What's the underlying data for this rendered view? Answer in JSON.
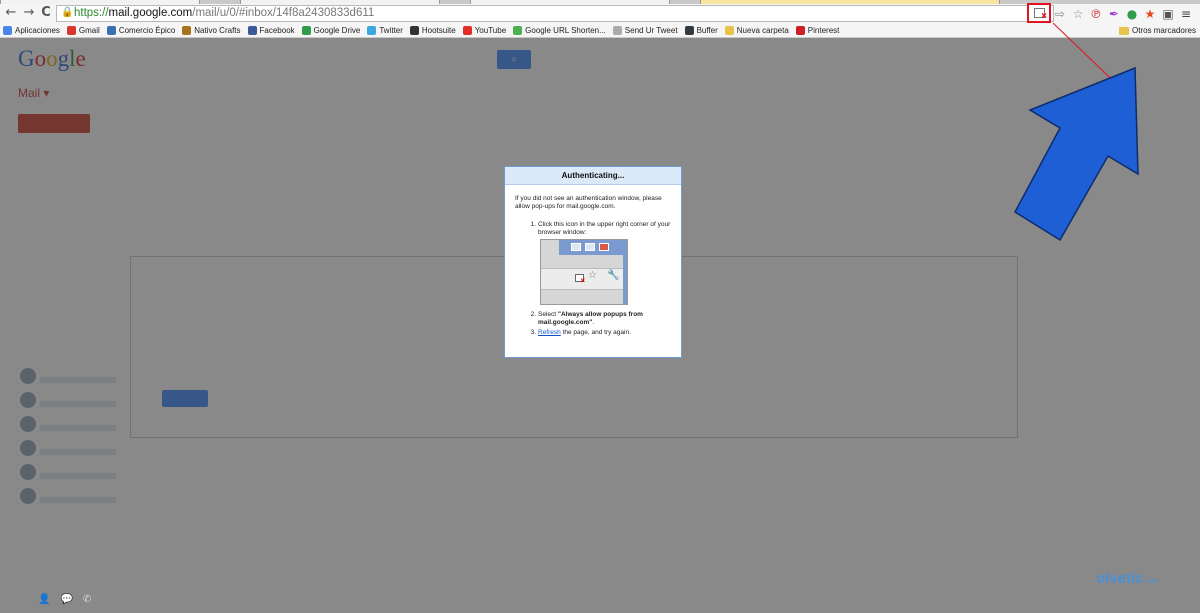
{
  "browser": {
    "nav": {
      "back": "←",
      "forward": "→",
      "reload": "C"
    },
    "url": {
      "scheme": "https://",
      "host": "mail.google.com",
      "path": "/mail/u/0/#inbox/14f8a2430833d611"
    },
    "bookmarks": [
      {
        "label": "Aplicaciones",
        "color": "#4a86e8"
      },
      {
        "label": "Gmail",
        "color": "#d9362f"
      },
      {
        "label": "Comercio Épico",
        "color": "#3a6fb4"
      },
      {
        "label": "Nativo Crafts",
        "color": "#a7731e"
      },
      {
        "label": "Facebook",
        "color": "#3b5998"
      },
      {
        "label": "Google Drive",
        "color": "#2f9d4b"
      },
      {
        "label": "Twitter",
        "color": "#3aa7e0"
      },
      {
        "label": "Hootsuite",
        "color": "#333333"
      },
      {
        "label": "YouTube",
        "color": "#e52d27"
      },
      {
        "label": "Google URL Shorten...",
        "color": "#4caf50"
      },
      {
        "label": "Send Ur Tweet",
        "color": "#aaaaaa"
      },
      {
        "label": "Buffer",
        "color": "#323b43"
      },
      {
        "label": "Nueva carpeta",
        "color": "#e8c44c"
      },
      {
        "label": "Pinterest",
        "color": "#cb2027"
      }
    ],
    "other_bookmarks": "Otros marcadores"
  },
  "dialog": {
    "title": "Authenticating...",
    "intro": "If you did not see an authentication window, please allow pop-ups for mail.google.com.",
    "step1_num": "1.",
    "step1": "Click this icon in the upper right corner of your browser window:",
    "step2_num": "2.",
    "step2_prefix": "Select ",
    "step2_bold": "\"Always allow popups from mail.google.com\"",
    "step2_suffix": ".",
    "step3_num": "3.",
    "step3_link": "Refresh",
    "step3_rest": " the page, and try again."
  },
  "watermark": {
    "brand": "olvetic",
    "suffix": ".com"
  },
  "colors": {
    "highlight": "#e0141e",
    "arrow": "#1f5fd6"
  }
}
